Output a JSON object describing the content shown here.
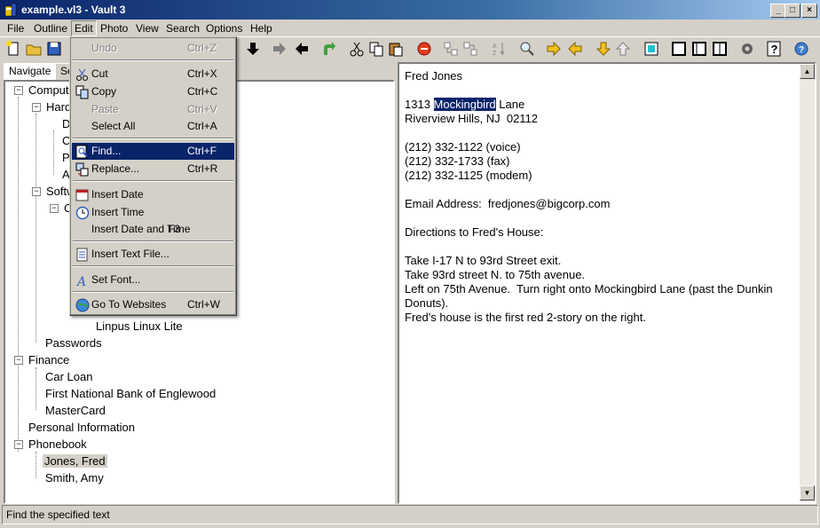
{
  "window": {
    "title": "example.vl3 - Vault 3"
  },
  "menubar": [
    "File",
    "Outline",
    "Edit",
    "Photo",
    "View",
    "Search",
    "Options",
    "Help"
  ],
  "tabs": [
    "Navigate",
    "Se"
  ],
  "tree": {
    "computer": "Comput",
    "hard": "Hard",
    "hard_children": [
      "D",
      "C",
      "P",
      "A"
    ],
    "soft": "Softw",
    "soft_child": "C",
    "linpus": "Linpus Linux Lite",
    "passwords": "Passwords",
    "finance": "Finance",
    "finance_items": [
      "Car Loan",
      "First National Bank of Englewood",
      "MasterCard"
    ],
    "personal": "Personal Information",
    "phonebook": "Phonebook",
    "phonebook_items": [
      "Jones, Fred",
      "Smith, Amy"
    ]
  },
  "note": {
    "name": "Fred Jones",
    "addr_num": "1313",
    "addr_sel": "Mockingbird",
    "addr_rest": "Lane",
    "city": "Riverview Hills, NJ  02112",
    "phone1": "(212) 332-1122 (voice)",
    "phone2": "(212) 332-1733 (fax)",
    "phone3": "(212) 332-1125 (modem)",
    "email": "Email Address:  fredjones@bigcorp.com",
    "dir_title": "Directions to Fred's House:",
    "dir1": "Take I-17 N to 93rd Street exit.",
    "dir2": "Take 93rd street N. to 75th avenue.",
    "dir3": "Left on 75th Avenue.  Turn right onto Mockingbird Lane (past the Dunkin",
    "dir3b": "Donuts).",
    "dir4": "Fred's house is the first red 2-story on the right."
  },
  "edit_menu": {
    "undo": "Undo",
    "undo_sc": "Ctrl+Z",
    "cut": "Cut",
    "cut_sc": "Ctrl+X",
    "copy": "Copy",
    "copy_sc": "Ctrl+C",
    "paste": "Paste",
    "paste_sc": "Ctrl+V",
    "select_all": "Select All",
    "select_all_sc": "Ctrl+A",
    "find": "Find...",
    "find_sc": "Ctrl+F",
    "replace": "Replace...",
    "replace_sc": "Ctrl+R",
    "insert_date": "Insert Date",
    "insert_time": "Insert Time",
    "insert_datetime": "Insert Date and Time",
    "insert_datetime_sc": "F3",
    "insert_file": "Insert Text File...",
    "set_font": "Set Font...",
    "websites": "Go To Websites",
    "websites_sc": "Ctrl+W"
  },
  "status": "Find the specified text",
  "colors": {
    "title_active": "#0a246a",
    "selection": "#0a246a",
    "face": "#d4d0c8"
  }
}
